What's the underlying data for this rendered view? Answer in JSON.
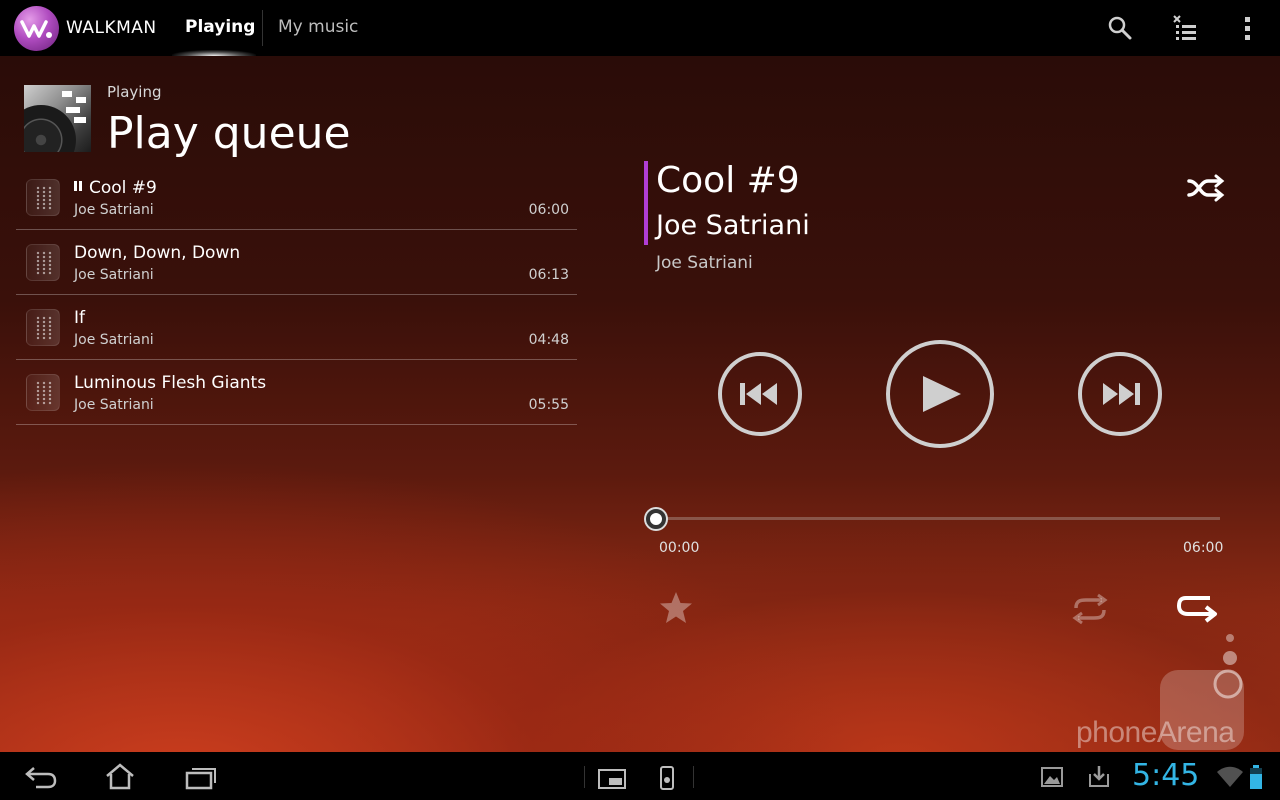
{
  "app": {
    "name": "WALKMAN",
    "tabs": [
      {
        "label": "Playing",
        "active": true
      },
      {
        "label": "My music",
        "active": false
      }
    ],
    "accent": "#b03ed4"
  },
  "header": {
    "subtitle": "Playing",
    "title": "Play queue"
  },
  "queue": [
    {
      "title": "Cool #9",
      "artist": "Joe Satriani",
      "duration": "06:00",
      "now_playing": true
    },
    {
      "title": "Down, Down, Down",
      "artist": "Joe Satriani",
      "duration": "06:13",
      "now_playing": false
    },
    {
      "title": "If",
      "artist": "Joe Satriani",
      "duration": "04:48",
      "now_playing": false
    },
    {
      "title": "Luminous Flesh Giants",
      "artist": "Joe Satriani",
      "duration": "05:55",
      "now_playing": false
    }
  ],
  "now_playing": {
    "title": "Cool #9",
    "artist": "Joe Satriani",
    "album": "Joe Satriani",
    "elapsed": "00:00",
    "total": "06:00",
    "progress": 0
  },
  "icons": {
    "actionbar": [
      "search-icon",
      "clear-queue-icon",
      "overflow-menu-icon"
    ],
    "controls": [
      "previous-icon",
      "play-icon",
      "next-icon",
      "shuffle-icon",
      "favorite-icon",
      "repeat-icon",
      "repeat-one-icon"
    ],
    "system": [
      "back-icon",
      "home-icon",
      "recent-apps-icon",
      "screenshot-icon",
      "walkman-small-icon",
      "gallery-icon",
      "download-icon",
      "wifi-icon",
      "battery-icon"
    ]
  },
  "watermark": "phoneArena",
  "status": {
    "clock": "5:45",
    "clock_color": "#33b5e5"
  }
}
